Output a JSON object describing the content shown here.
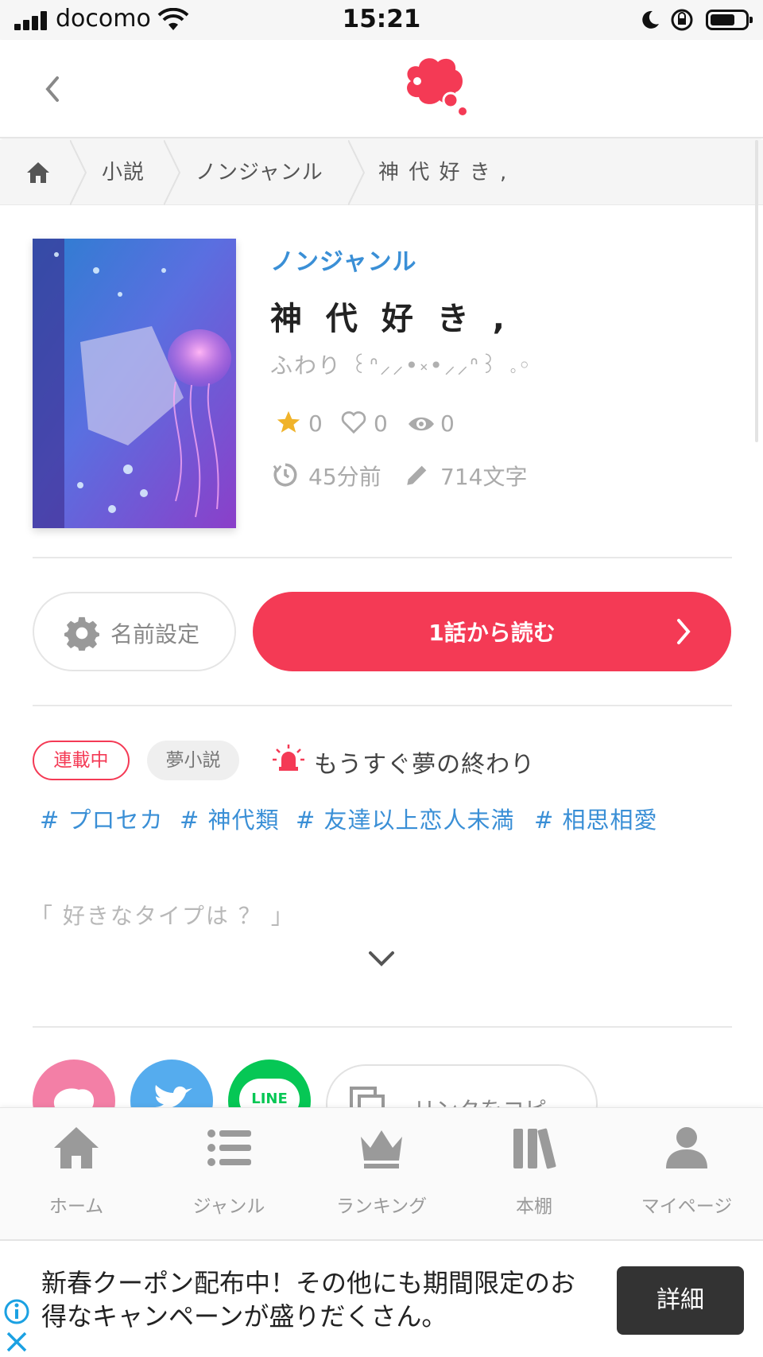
{
  "status_bar": {
    "carrier": "docomo",
    "time": "15:21"
  },
  "header": {
    "back_icon": "chevron-left-icon",
    "logo_icon": "cloud-logo-icon",
    "accent": "#f43a55"
  },
  "breadcrumb": {
    "items": [
      "小説",
      "ノンジャンル",
      "神 代 好 き ,"
    ]
  },
  "novel": {
    "genre": "ノンジャンル",
    "title": "神 代 好 き ,",
    "author": "ふわり ꒰ᐢ⸝⸝•༝•⸝⸝ᐢ꒱ ｡◦",
    "stars": "0",
    "likes": "0",
    "views": "0",
    "updated": "45分前",
    "chars": "714文字"
  },
  "actions": {
    "name_settings": "名前設定",
    "read_first": "1話から読む"
  },
  "badges": {
    "serial": "連載中",
    "type": "夢小説",
    "status": "もうすぐ夢の終わり"
  },
  "tags": [
    "# プロセカ",
    "# 神代類",
    "# 友達以上恋人未満",
    "# 相思相愛"
  ],
  "description": "「 好きなタイプは ？ 」",
  "share": {
    "line_label": "LINE",
    "copy_link": "リンクをコピー"
  },
  "tabbar": {
    "items": [
      "ホーム",
      "ジャンル",
      "ランキング",
      "本棚",
      "マイページ"
    ]
  },
  "ad": {
    "text": "新春クーポン配布中！その他にも期間限定のお得なキャンペーンが盛りだくさん。",
    "button": "詳細"
  }
}
